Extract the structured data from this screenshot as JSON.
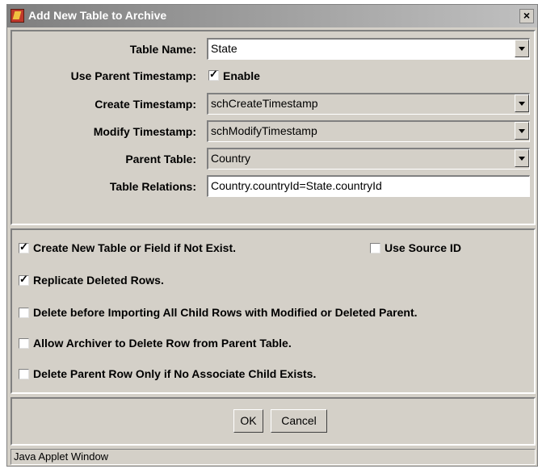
{
  "window": {
    "title": "Add New Table to Archive",
    "close_label": "×"
  },
  "form": {
    "table_name": {
      "label": "Table Name:",
      "value": "State"
    },
    "use_parent_timestamp": {
      "label": "Use Parent Timestamp:",
      "checkbox_label": "Enable",
      "checked": true
    },
    "create_timestamp": {
      "label": "Create Timestamp:",
      "value": "schCreateTimestamp"
    },
    "modify_timestamp": {
      "label": "Modify Timestamp:",
      "value": "schModifyTimestamp"
    },
    "parent_table": {
      "label": "Parent Table:",
      "value": "Country"
    },
    "table_relations": {
      "label": "Table Relations:",
      "value": "Country.countryId=State.countryId"
    }
  },
  "options": {
    "create_new_table": {
      "label": "Create New Table or Field if Not Exist.",
      "checked": true
    },
    "use_source_id": {
      "label": "Use Source ID",
      "checked": false
    },
    "replicate_deleted": {
      "label": "Replicate Deleted Rows.",
      "checked": true
    },
    "delete_before_importing": {
      "label": "Delete before Importing All Child Rows with Modified or Deleted Parent.",
      "checked": false
    },
    "allow_archiver_delete": {
      "label": "Allow Archiver to Delete Row from Parent Table.",
      "checked": false
    },
    "delete_parent_only": {
      "label": "Delete Parent Row Only if No Associate Child Exists.",
      "checked": false
    }
  },
  "buttons": {
    "ok_label": "OK",
    "cancel_label": "Cancel"
  },
  "status": {
    "text": "Java Applet Window"
  },
  "check_glyph": "✓"
}
